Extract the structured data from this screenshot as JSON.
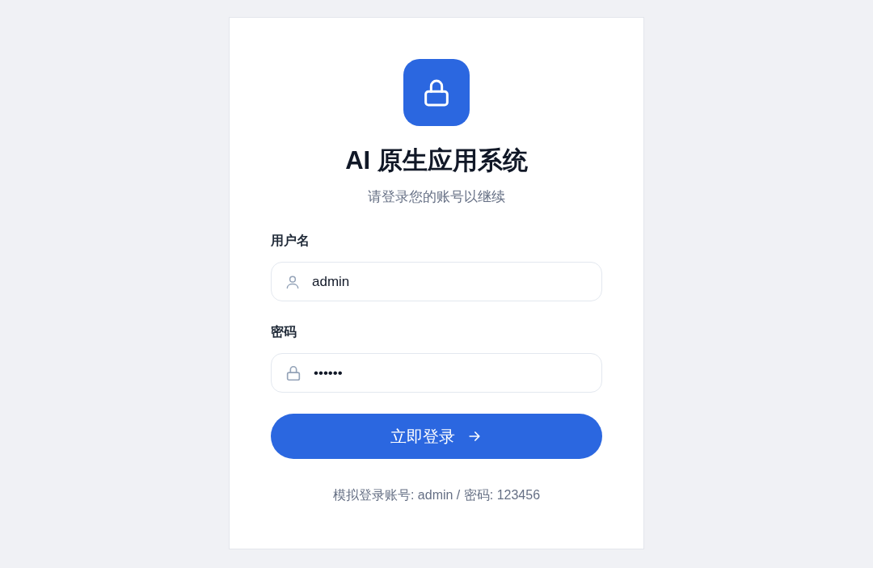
{
  "title": "AI 原生应用系统",
  "subtitle": "请登录您的账号以继续",
  "fields": [
    {
      "label": "用户名",
      "value": "admin",
      "kind": "user"
    },
    {
      "label": "密码",
      "value": "••••••",
      "kind": "password"
    }
  ],
  "submit": "立即登录",
  "hint": "模拟登录账号: admin / 密码: 123456"
}
